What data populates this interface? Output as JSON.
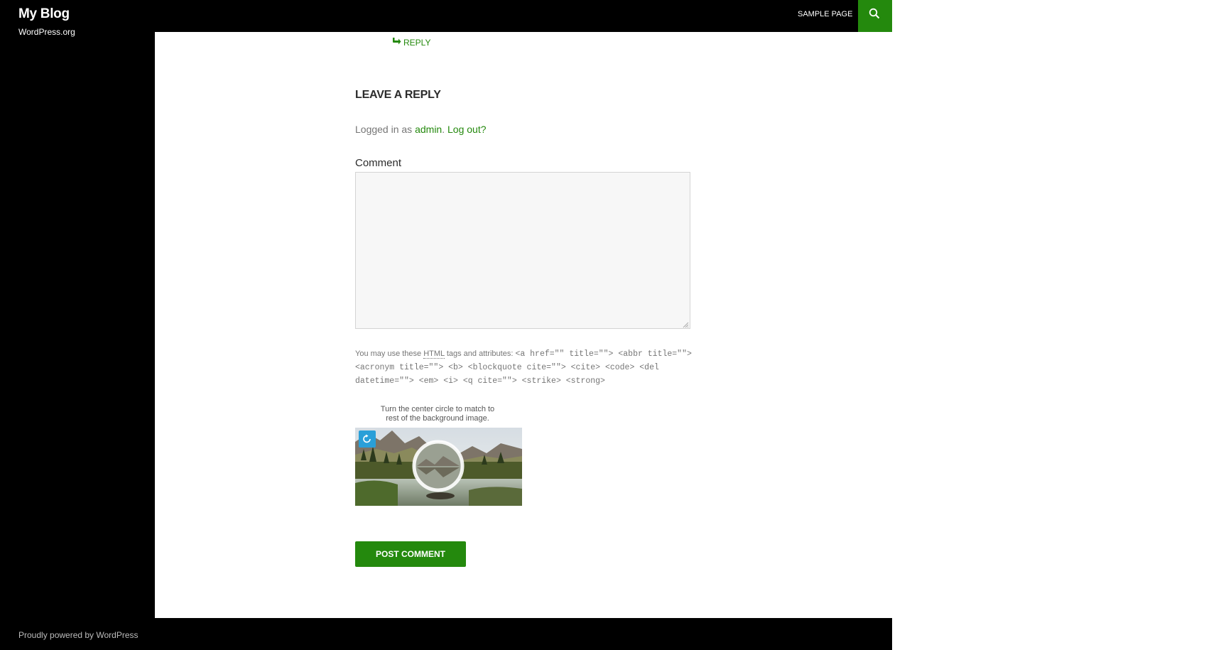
{
  "header": {
    "site_title": "My Blog",
    "nav_items": [
      "SAMPLE PAGE"
    ],
    "search_icon": "search-icon"
  },
  "sidebar": {
    "description": "WordPress.org"
  },
  "comment_reply": {
    "reply_label": "REPLY",
    "reply_icon": "reply-arrow-icon"
  },
  "respond": {
    "title": "LEAVE A REPLY",
    "logged_in_prefix": "Logged in as ",
    "user": "admin",
    "separator": ". ",
    "logout": "Log out?",
    "comment_label": "Comment",
    "comment_value": "",
    "allowed_prefix": "You may use these ",
    "allowed_abbr": "HTML",
    "allowed_suffix": " tags and attributes: ",
    "allowed_tags": "<a href=\"\" title=\"\"> <abbr title=\"\"> <acronym title=\"\"> <b> <blockquote cite=\"\"> <cite> <code> <del datetime=\"\"> <em> <i> <q cite=\"\"> <strike> <strong>",
    "captcha_instruction": "Turn the center circle to match to rest of the background image.",
    "captcha_refresh_icon": "refresh-icon",
    "submit_label": "POST COMMENT"
  },
  "footer": {
    "powered_by": "Proudly powered by WordPress"
  },
  "colors": {
    "accent": "#24890d",
    "header_bg": "#000000",
    "captcha_refresh": "#2a9fd8"
  }
}
